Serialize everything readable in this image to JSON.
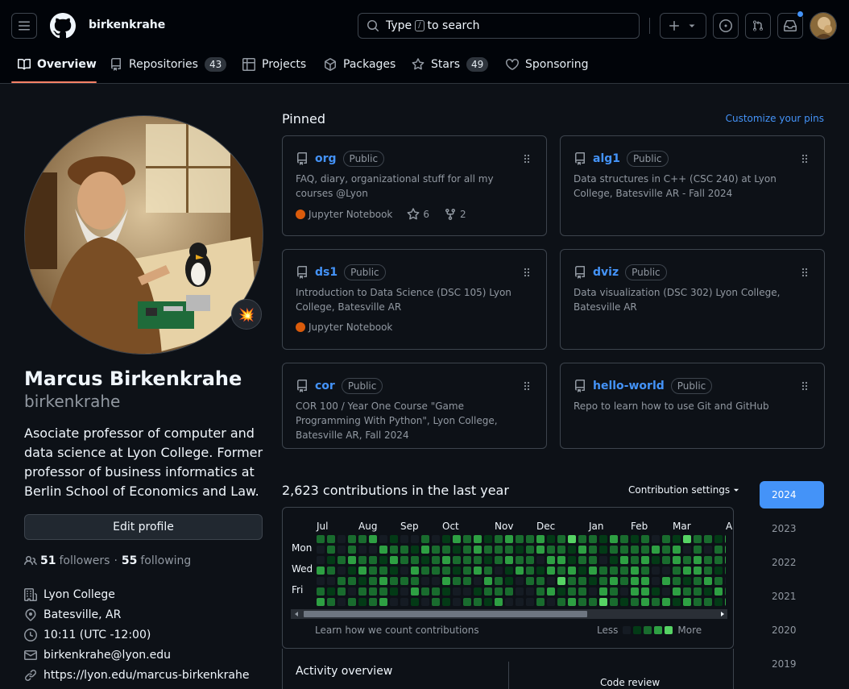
{
  "header": {
    "username": "birkenkrahe",
    "search_prefix": "Type",
    "search_slash": "/",
    "search_suffix": "to search"
  },
  "tabs": [
    {
      "label": "Overview",
      "count": ""
    },
    {
      "label": "Repositories",
      "count": "43"
    },
    {
      "label": "Projects",
      "count": ""
    },
    {
      "label": "Packages",
      "count": ""
    },
    {
      "label": "Stars",
      "count": "49"
    },
    {
      "label": "Sponsoring",
      "count": ""
    }
  ],
  "profile": {
    "status_emoji": "💥",
    "full_name": "Marcus Birkenkrahe",
    "login": "birkenkrahe",
    "bio": "Asociate professor of computer and data science at Lyon College. Former professor of business informatics at Berlin School of Economics and Law.",
    "edit_label": "Edit profile",
    "followers_count": "51",
    "followers_label": "followers",
    "separator": "·",
    "following_count": "55",
    "following_label": "following",
    "organization": "Lyon College",
    "location": "Batesville, AR",
    "local_time": "10:11 (UTC -12:00)",
    "email": "birkenkrahe@lyon.edu",
    "website": "https://lyon.edu/marcus-birkenkrahe"
  },
  "pinned": {
    "title": "Pinned",
    "customize_label": "Customize your pins",
    "repos": [
      {
        "name": "org",
        "visibility": "Public",
        "description": "FAQ, diary, organizational stuff for all my courses @Lyon",
        "language": "Jupyter Notebook",
        "stars": "6",
        "forks": "2"
      },
      {
        "name": "alg1",
        "visibility": "Public",
        "description": "Data structures in C++ (CSC 240) at Lyon College, Batesville AR - Fall 2024",
        "language": "",
        "stars": "",
        "forks": ""
      },
      {
        "name": "ds1",
        "visibility": "Public",
        "description": "Introduction to Data Science (DSC 105) Lyon College, Batesville AR",
        "language": "Jupyter Notebook",
        "stars": "",
        "forks": ""
      },
      {
        "name": "dviz",
        "visibility": "Public",
        "description": "Data visualization (DSC 302) Lyon College, Batesville AR",
        "language": "",
        "stars": "",
        "forks": ""
      },
      {
        "name": "cor",
        "visibility": "Public",
        "description": "COR 100 / Year One Course \"Game Programming With Python\", Lyon College, Batesville AR, Fall 2024",
        "language": "",
        "stars": "",
        "forks": ""
      },
      {
        "name": "hello-world",
        "visibility": "Public",
        "description": "Repo to learn how to use Git and GitHub",
        "language": "",
        "stars": "",
        "forks": ""
      }
    ]
  },
  "contributions": {
    "summary": "2,623 contributions in the last year",
    "settings_label": "Contribution settings",
    "months": [
      "Jul",
      "Aug",
      "Sep",
      "Oct",
      "Nov",
      "Dec",
      "Jan",
      "Feb",
      "Mar",
      "A"
    ],
    "days": [
      "Mon",
      "Wed",
      "Fri"
    ],
    "learn_label": "Learn how we count contributions",
    "less_label": "Less",
    "more_label": "More",
    "legend_colors": [
      "#151b23",
      "#033a16",
      "#196c2e",
      "#2ea043",
      "#56d364"
    ]
  },
  "years": [
    "2024",
    "2023",
    "2022",
    "2021",
    "2020",
    "2019"
  ],
  "activity": {
    "title": "Activity overview",
    "code_review_label": "Code review"
  },
  "colors": {
    "accent": "#4493f8",
    "tab_underline": "#f78166",
    "language_jupyter": "#da5b0b"
  }
}
